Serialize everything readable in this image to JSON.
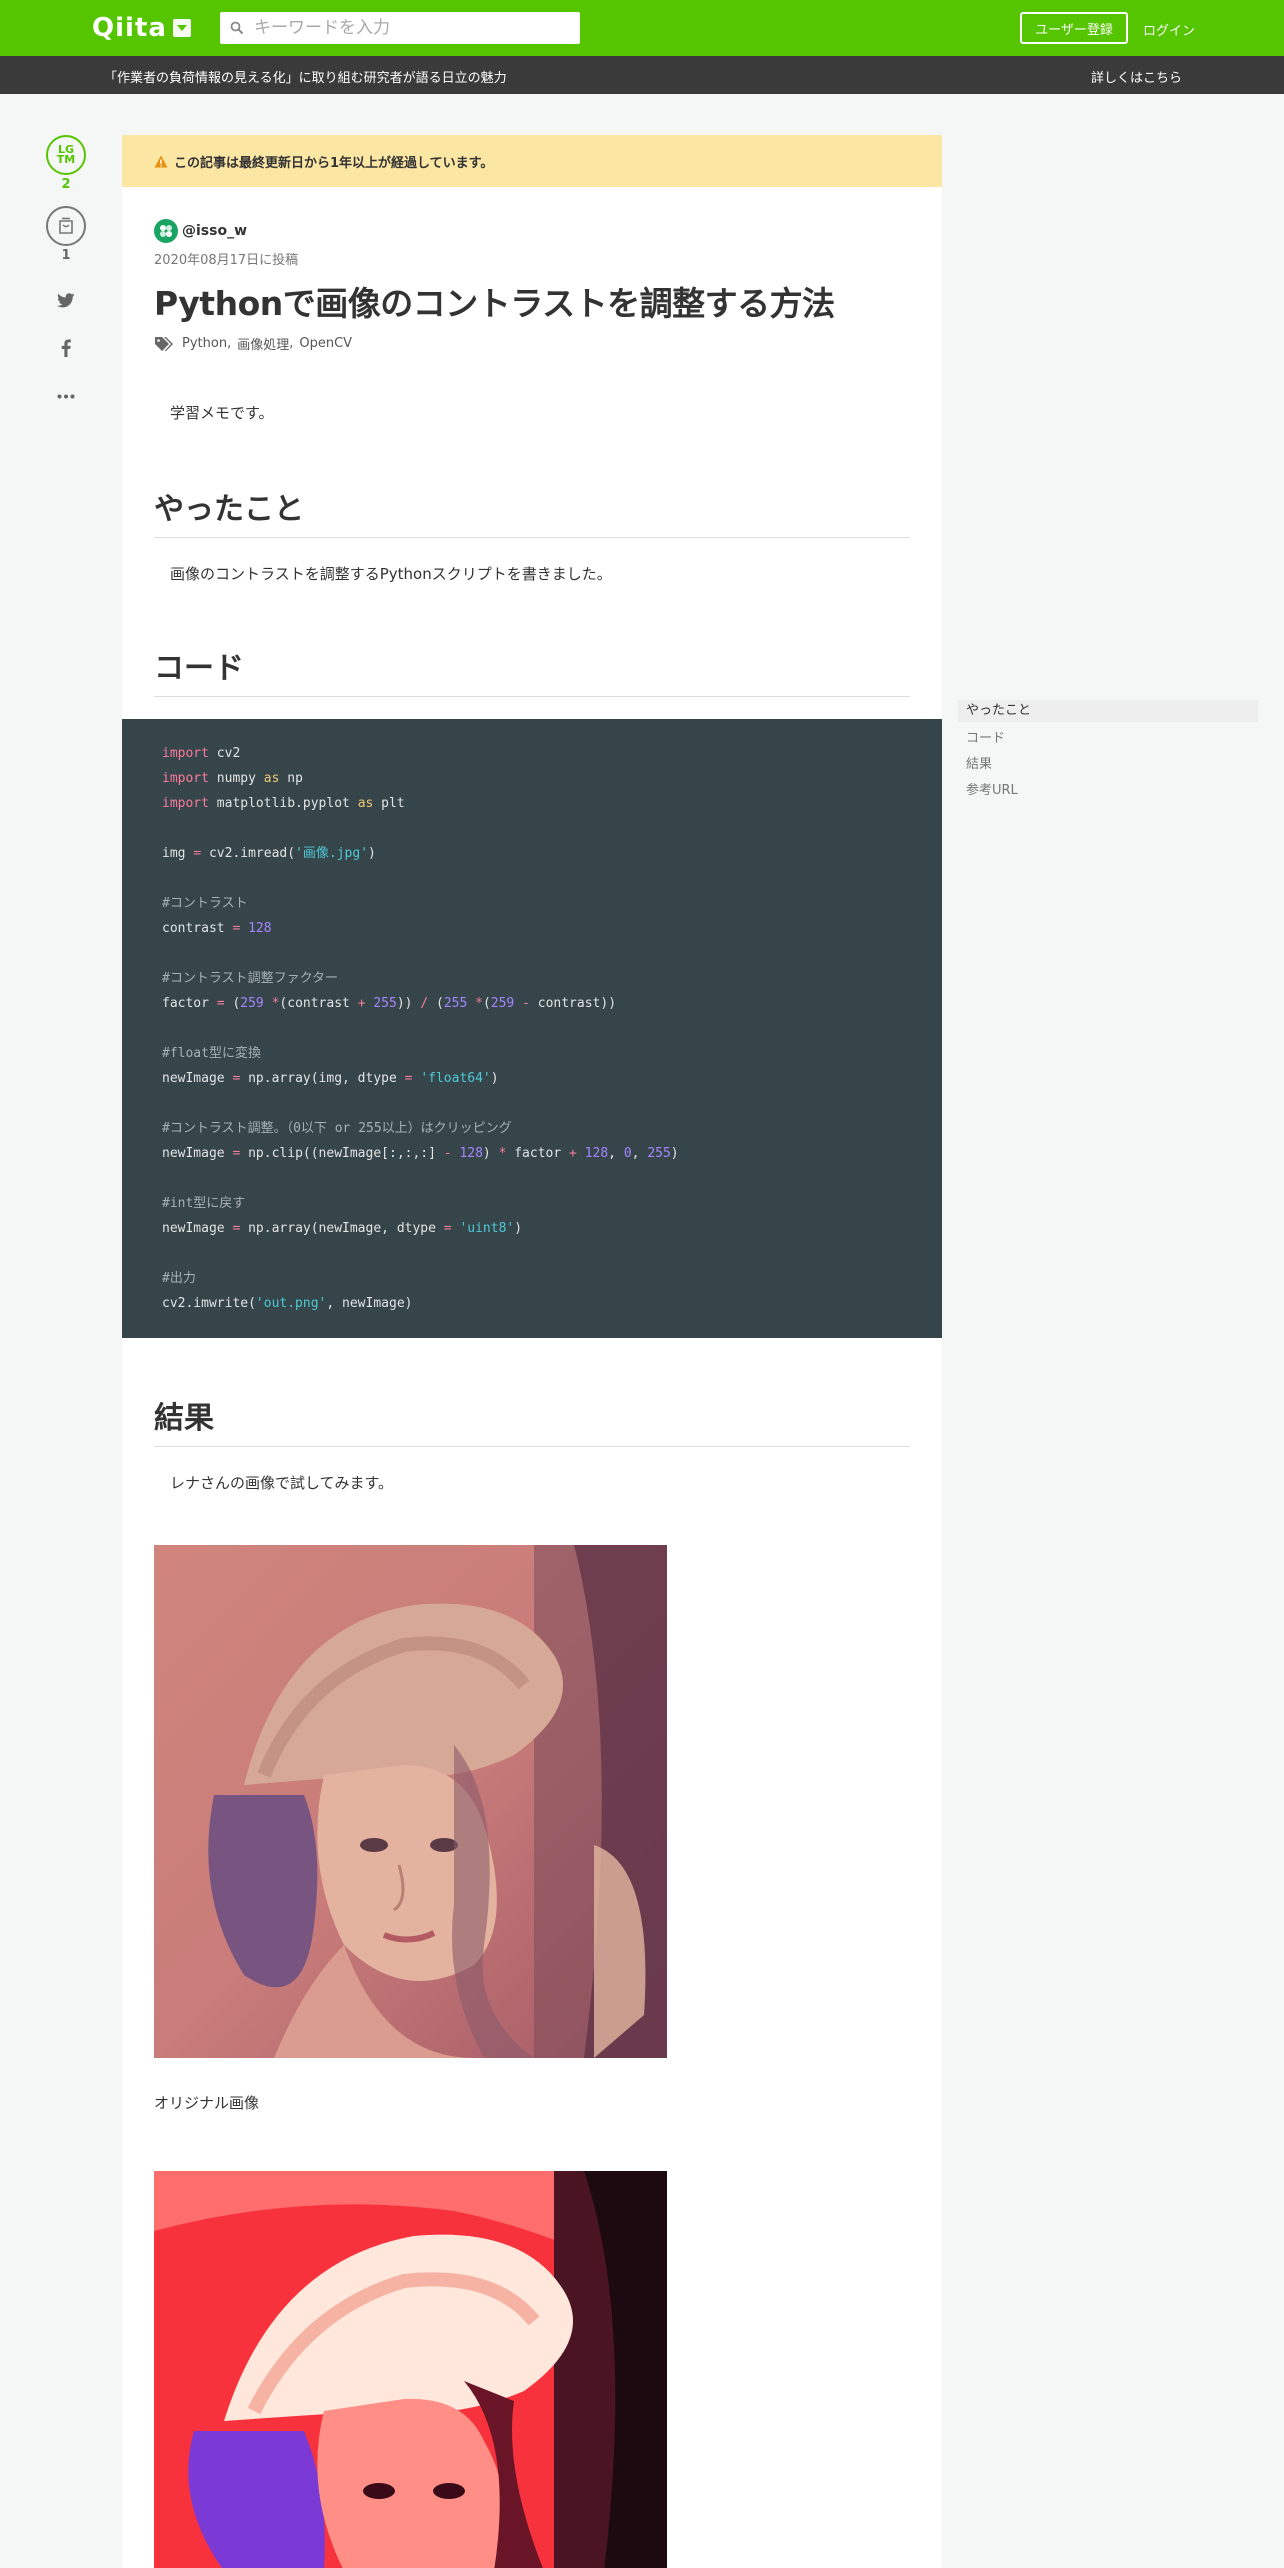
{
  "header": {
    "logo_text": "Qiita",
    "search_placeholder": "キーワードを入力",
    "signup_label": "ユーザー登録",
    "login_label": "ログイン"
  },
  "promo": {
    "text": "「作業者の負荷情報の見える化」に取り組む研究者が語る日立の魅力",
    "link": "詳しくはこちら"
  },
  "actions": {
    "lgtm_top": "LG",
    "lgtm_bottom": "TM",
    "lgtm_count": "2",
    "stock_count": "1"
  },
  "article": {
    "warning": "この記事は最終更新日から1年以上が経過しています。",
    "author": "@isso_w",
    "date": "2020年08月17日に投稿",
    "title": "Pythonで画像のコントラストを調整する方法",
    "tags": [
      "Python",
      "画像処理",
      "OpenCV"
    ],
    "intro": "学習メモです。",
    "section1_title": "やったこと",
    "section1_text": "画像のコントラストを調整するPythonスクリプトを書きました。",
    "section2_title": "コード",
    "section3_title": "結果",
    "section3_text": "レナさんの画像で試してみます。",
    "caption_original": "オリジナル画像"
  },
  "toc": {
    "items": [
      "やったこと",
      "コード",
      "結果",
      "参考URL"
    ]
  },
  "colors": {
    "brand": "#55c500",
    "promo_bg": "#3a3a3a",
    "code_bg": "#364549",
    "warning_bg": "#fbe6a4"
  }
}
